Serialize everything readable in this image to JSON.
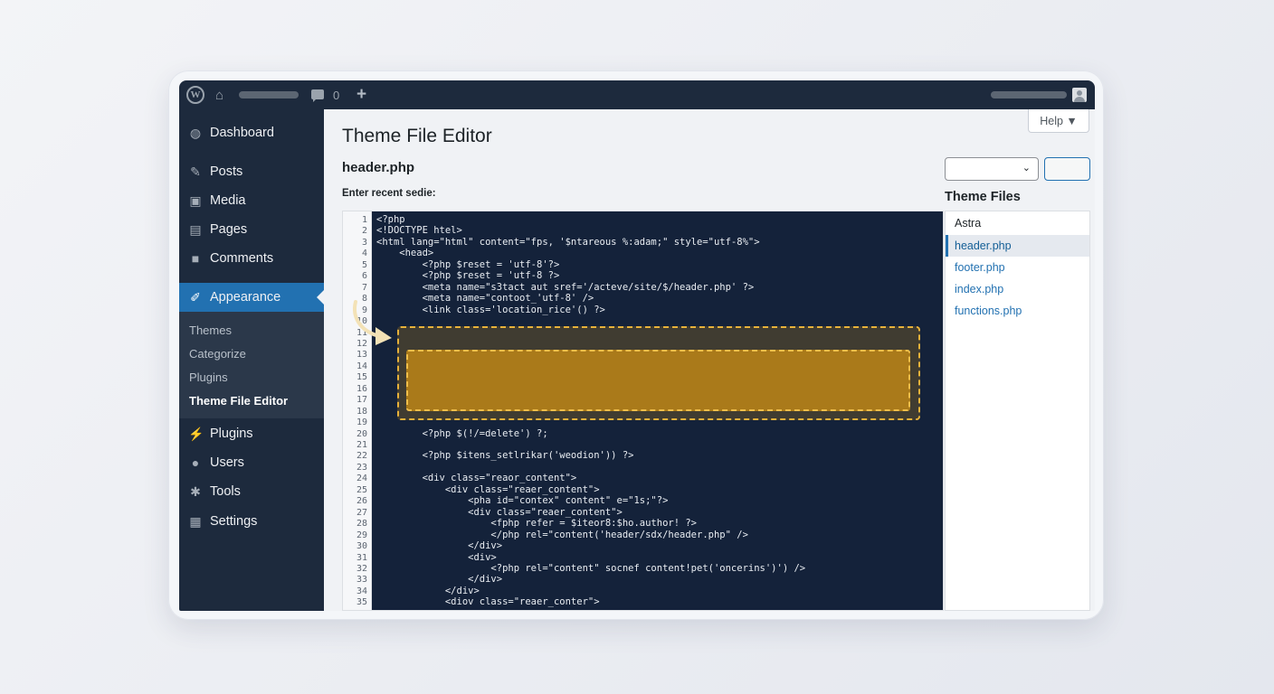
{
  "admin_bar": {
    "comment_count": "0"
  },
  "sidebar": {
    "items": [
      {
        "label": "Dashboard",
        "icon": "dashboard-icon"
      },
      {
        "label": "Posts",
        "icon": "pin-icon"
      },
      {
        "label": "Media",
        "icon": "media-icon"
      },
      {
        "label": "Pages",
        "icon": "pages-icon"
      },
      {
        "label": "Comments",
        "icon": "comment-icon"
      },
      {
        "label": "Appearance",
        "icon": "brush-icon"
      },
      {
        "label": "Plugins",
        "icon": "plugin-icon"
      },
      {
        "label": "Users",
        "icon": "user-icon"
      },
      {
        "label": "Tools",
        "icon": "wrench-icon"
      },
      {
        "label": "Settings",
        "icon": "settings-icon"
      }
    ],
    "submenu": [
      "Themes",
      "Categorize",
      "Plugins",
      "Theme File Editor"
    ]
  },
  "main": {
    "help_label": "Help ▼",
    "page_title": "Theme File Editor",
    "file_name": "header.php",
    "content_label": "Enter recent sedie:",
    "theme_files_heading": "Theme Files",
    "theme_files": [
      "Astra",
      "header.php",
      "footer.php",
      "index.php",
      "functions.php"
    ]
  },
  "editor": {
    "line_numbers": [
      "1",
      "2",
      "3",
      "4",
      "5",
      "6",
      "7",
      "8",
      "9",
      "10",
      "11",
      "12",
      "13",
      "14",
      "15",
      "16",
      "17",
      "18",
      "19",
      "20",
      "21",
      "22",
      "23",
      "24",
      "25",
      "26",
      "27",
      "28",
      "29",
      "30",
      "31",
      "32",
      "33",
      "34",
      "35"
    ],
    "lines": [
      "<?php",
      "<!DOCTYPE htel>",
      "<html lang=\"html\" content=\"fps, '$ntareous %:adam;\" style=\"utf-8%\">",
      "    <head>",
      "        <?php $reset = 'utf-8'?>",
      "        <?php $reset = 'utf-8 ?>",
      "        <meta name=\"s3tact aut sref='/acteve/site/$/header.php' ?>",
      "        <meta name=\"contoot_'utf-8' />",
      "        <link class='location_rice'() ?>",
      "",
      "",
      "",
      "",
      "",
      "",
      "",
      "",
      "",
      "",
      "        <?php $(!/=delete') ?;",
      "",
      "        <?php $itens_setlrikar('weodion')) ?>",
      "",
      "        <div class=\"reaor_content\">",
      "            <div class=\"reaer_content\">",
      "                <pha id=\"contex\" content\" e=\"1s;\"?>",
      "                <div class=\"reaer_content\">",
      "                    <fphp refer = $iteor8:$ho.author! ?>",
      "                    </php rel=\"content('header/sdx/header.php\" />",
      "                </div>",
      "                <div>",
      "                    <?php rel=\"content\" socnef content!pet('oncerins')') />",
      "                </div>",
      "            </div>",
      "            <diov class=\"reaer_conter\">"
    ]
  }
}
